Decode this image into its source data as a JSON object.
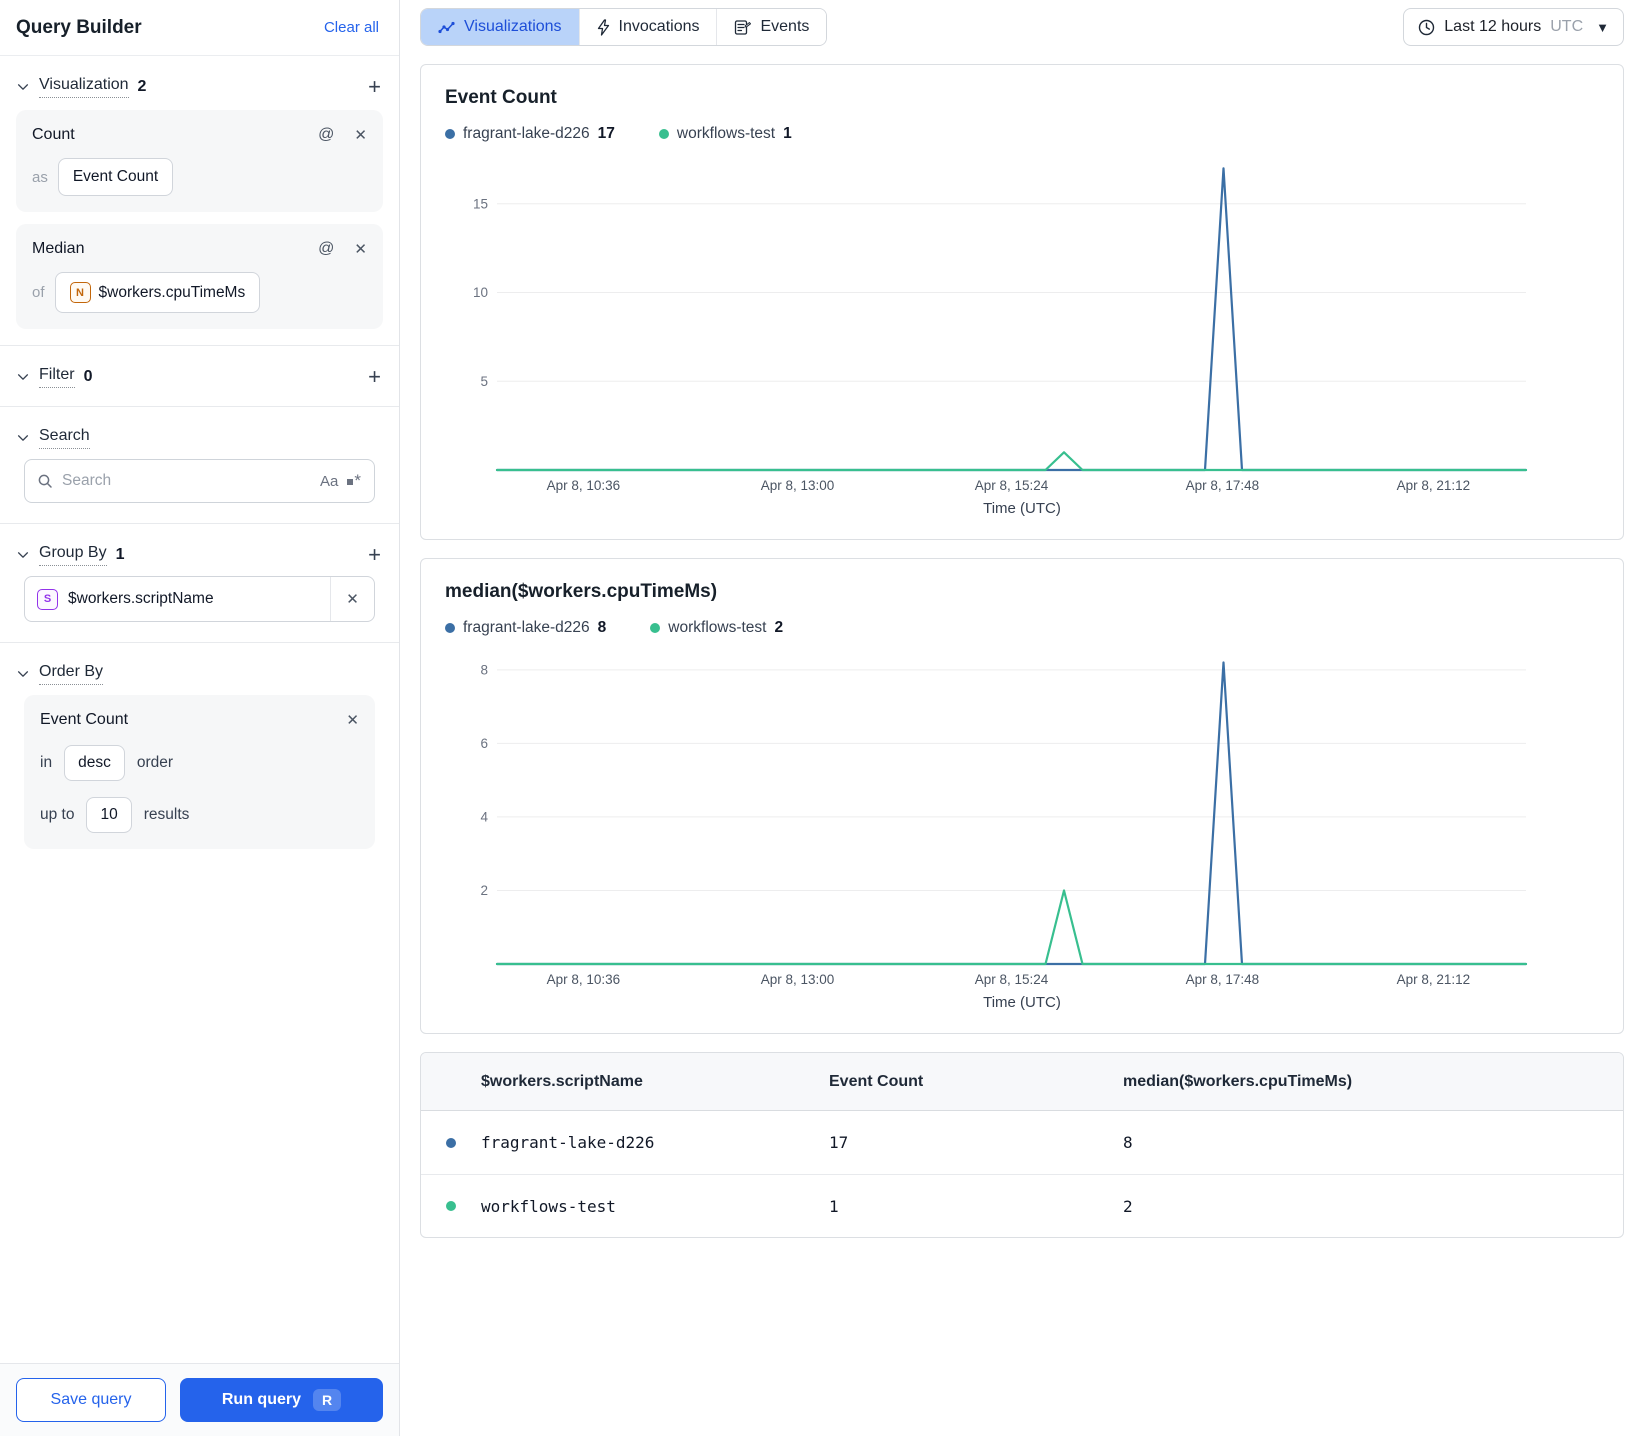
{
  "sidebar": {
    "title": "Query Builder",
    "clear_all_label": "Clear all",
    "visualization": {
      "label": "Visualization",
      "count": "2",
      "cards": [
        {
          "title": "Count",
          "prefix": "as",
          "value": "Event Count"
        },
        {
          "title": "Median",
          "prefix": "of",
          "badge": "N",
          "value": "$workers.cpuTimeMs"
        }
      ]
    },
    "filter": {
      "label": "Filter",
      "count": "0"
    },
    "search": {
      "label": "Search",
      "placeholder": "Search",
      "case_icon_label": "Aa"
    },
    "group_by": {
      "label": "Group By",
      "count": "1",
      "badge": "S",
      "value": "$workers.scriptName"
    },
    "order_by": {
      "label": "Order By",
      "field": "Event Count",
      "in_label": "in",
      "direction": "desc",
      "order_label": "order",
      "up_to_label": "up to",
      "limit": "10",
      "results_label": "results"
    },
    "save_query_label": "Save query",
    "run_query_label": "Run query",
    "run_query_kbd": "R"
  },
  "topbar": {
    "tabs": [
      {
        "label": "Visualizations",
        "active": true
      },
      {
        "label": "Invocations",
        "active": false
      },
      {
        "label": "Events",
        "active": false
      }
    ],
    "time_range": {
      "range_label": "Last 12 hours",
      "timezone": "UTC"
    }
  },
  "colors": {
    "series_blue": "#3b6fa5",
    "series_green": "#38bf8f",
    "accent_blue": "#2563eb",
    "active_tab_bg": "#b9d3f9"
  },
  "chart_data": [
    {
      "type": "line",
      "title": "Event Count",
      "xlabel": "Time (UTC)",
      "ylim": [
        0,
        17.3
      ],
      "yticks": [
        5,
        10,
        15
      ],
      "grid": true,
      "legend_position": "top",
      "xticks": [
        {
          "pos": 0.084,
          "label": "Apr 8, 10:36"
        },
        {
          "pos": 0.292,
          "label": "Apr 8, 13:00"
        },
        {
          "pos": 0.5,
          "label": "Apr 8, 15:24"
        },
        {
          "pos": 0.705,
          "label": "Apr 8, 17:48"
        },
        {
          "pos": 0.91,
          "label": "Apr 8, 21:12"
        }
      ],
      "legend": [
        {
          "name": "fragrant-lake-d226",
          "value": "17",
          "color": "#3b6fa5"
        },
        {
          "name": "workflows-test",
          "value": "1",
          "color": "#38bf8f"
        }
      ],
      "series": [
        {
          "name": "fragrant-lake-d226",
          "color": "#3b6fa5",
          "points": [
            [
              0,
              0
            ],
            [
              0.688,
              0
            ],
            [
              0.706,
              17
            ],
            [
              0.724,
              0
            ],
            [
              1,
              0
            ]
          ]
        },
        {
          "name": "workflows-test",
          "color": "#38bf8f",
          "points": [
            [
              0,
              0
            ],
            [
              0.533,
              0
            ],
            [
              0.551,
              1
            ],
            [
              0.569,
              0
            ],
            [
              1,
              0
            ]
          ]
        }
      ]
    },
    {
      "type": "line",
      "title": "median($workers.cpuTimeMs)",
      "xlabel": "Time (UTC)",
      "ylim": [
        0,
        8.35
      ],
      "yticks": [
        2,
        4,
        6,
        8
      ],
      "grid": true,
      "legend_position": "top",
      "xticks": [
        {
          "pos": 0.084,
          "label": "Apr 8, 10:36"
        },
        {
          "pos": 0.292,
          "label": "Apr 8, 13:00"
        },
        {
          "pos": 0.5,
          "label": "Apr 8, 15:24"
        },
        {
          "pos": 0.705,
          "label": "Apr 8, 17:48"
        },
        {
          "pos": 0.91,
          "label": "Apr 8, 21:12"
        }
      ],
      "legend": [
        {
          "name": "fragrant-lake-d226",
          "value": "8",
          "color": "#3b6fa5"
        },
        {
          "name": "workflows-test",
          "value": "2",
          "color": "#38bf8f"
        }
      ],
      "series": [
        {
          "name": "fragrant-lake-d226",
          "color": "#3b6fa5",
          "points": [
            [
              0,
              0
            ],
            [
              0.688,
              0
            ],
            [
              0.706,
              8.2
            ],
            [
              0.724,
              0
            ],
            [
              1,
              0
            ]
          ]
        },
        {
          "name": "workflows-test",
          "color": "#38bf8f",
          "points": [
            [
              0,
              0
            ],
            [
              0.533,
              0
            ],
            [
              0.551,
              2
            ],
            [
              0.569,
              0
            ],
            [
              1,
              0
            ]
          ]
        }
      ]
    }
  ],
  "table": {
    "columns": [
      "$workers.scriptName",
      "Event Count",
      "median($workers.cpuTimeMs)"
    ],
    "rows": [
      {
        "name": "fragrant-lake-d226",
        "color": "#3b6fa5",
        "event_count": "17",
        "median": "8"
      },
      {
        "name": "workflows-test",
        "color": "#38bf8f",
        "event_count": "1",
        "median": "2"
      }
    ]
  }
}
